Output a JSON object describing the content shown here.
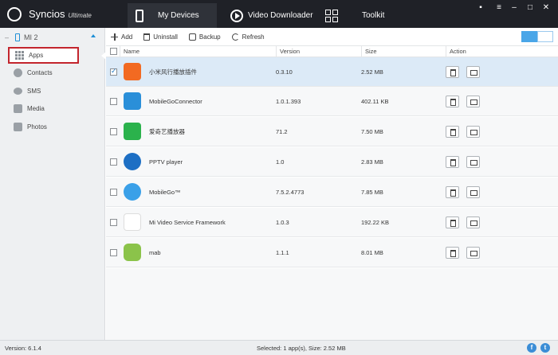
{
  "app": {
    "brand": "Syncios",
    "edition": "Ultimate",
    "nav": [
      {
        "label": "My Devices",
        "icon": "phone-icon",
        "active": true
      },
      {
        "label": "Video Downloader",
        "icon": "play-icon",
        "active": false
      },
      {
        "label": "Toolkit",
        "icon": "grid-icon",
        "active": false
      }
    ],
    "window_controls": {
      "chat": "▪",
      "menu": "≡",
      "minimize": "–",
      "maximize": "□",
      "close": "✕"
    }
  },
  "sidebar": {
    "device": "MI 2",
    "items": [
      {
        "label": "Apps",
        "icon": "apps-icon",
        "active": true
      },
      {
        "label": "Contacts",
        "icon": "contacts-icon",
        "active": false
      },
      {
        "label": "SMS",
        "icon": "sms-icon",
        "active": false
      },
      {
        "label": "Media",
        "icon": "media-icon",
        "active": false
      },
      {
        "label": "Photos",
        "icon": "photos-icon",
        "active": false
      }
    ]
  },
  "toolbar": {
    "add_label": "Add",
    "uninstall_label": "Uninstall",
    "backup_label": "Backup",
    "refresh_label": "Refresh"
  },
  "table": {
    "columns": [
      "Name",
      "Version",
      "Size",
      "Action"
    ],
    "rows": [
      {
        "name": "小米风行播放插件",
        "version": "0.3.10",
        "size": "2.52 MB",
        "selected": true,
        "icon_color": "#f26a22"
      },
      {
        "name": "MobileGoConnector",
        "version": "1.0.1.393",
        "size": "402.11 KB",
        "selected": false,
        "icon_color": "#2a8fd9"
      },
      {
        "name": "爱奇艺播放器",
        "version": "71.2",
        "size": "7.50 MB",
        "selected": false,
        "icon_color": "#2bb24c"
      },
      {
        "name": "PPTV player",
        "version": "1.0",
        "size": "2.83 MB",
        "selected": false,
        "icon_color": "#1d6fc4"
      },
      {
        "name": "MobileGo™",
        "version": "7.5.2.4773",
        "size": "7.85 MB",
        "selected": false,
        "icon_color": "#3aa0e8"
      },
      {
        "name": "Mi Video Service Framework",
        "version": "1.0.3",
        "size": "192.22 KB",
        "selected": false,
        "icon_color": "#ffffff"
      },
      {
        "name": "mab",
        "version": "1.1.1",
        "size": "8.01 MB",
        "selected": false,
        "icon_color": "#8bc34a"
      }
    ]
  },
  "status": {
    "version": "Version: 6.1.4",
    "selection": "Selected: 1 app(s), Size: 2.52 MB",
    "facebook": "f",
    "twitter": "t"
  },
  "colors": {
    "titlebar": "#1f2127",
    "accent": "#1e8fd6",
    "selected_row": "#dceaf7",
    "highlight_box": "#c3252d"
  }
}
